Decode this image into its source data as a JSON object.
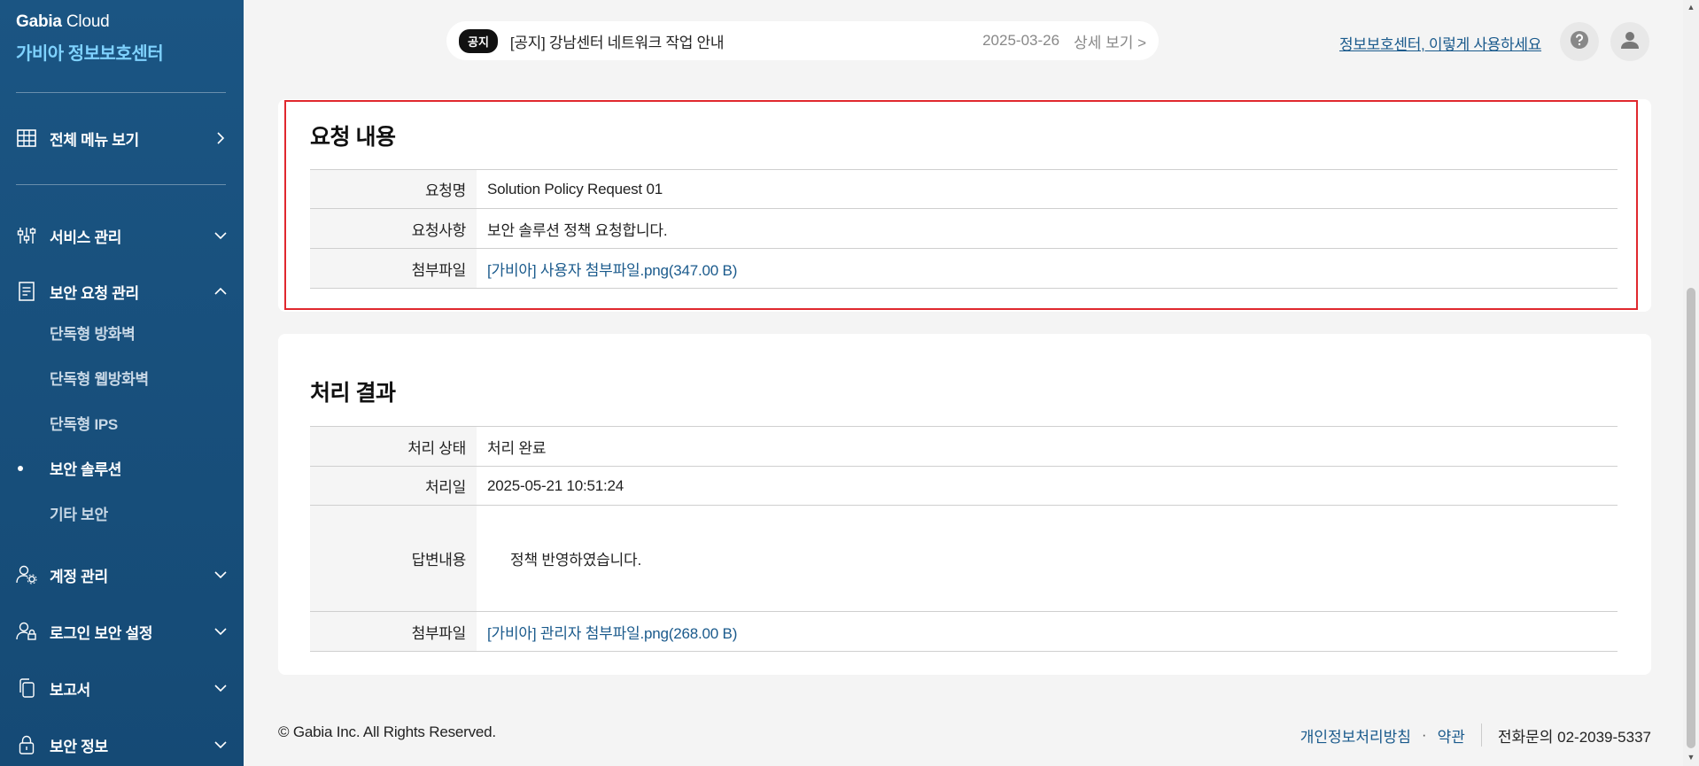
{
  "brand": {
    "company": "Gabia",
    "product": "Cloud",
    "subtitle": "가비아 정보보호센터"
  },
  "sidebar": {
    "all_menu": "전체 메뉴 보기",
    "groups": [
      {
        "label": "서비스 관리",
        "icon": "sliders-icon"
      },
      {
        "label": "보안 요청 관리",
        "icon": "document-icon"
      },
      {
        "label": "계정 관리",
        "icon": "user-gear-icon"
      },
      {
        "label": "로그인 보안 설정",
        "icon": "user-lock-icon"
      },
      {
        "label": "보고서",
        "icon": "copy-icon"
      },
      {
        "label": "보안 정보",
        "icon": "lock-icon"
      }
    ],
    "sub_items": [
      "단독형 방화벽",
      "단독형 웹방화벽",
      "단독형 IPS",
      "보안 솔루션",
      "기타 보안"
    ],
    "active_sub": "보안 솔루션"
  },
  "notice": {
    "badge": "공지",
    "text": "[공지] 강남센터 네트워크 작업 안내",
    "date": "2025-03-26",
    "more": "상세 보기 >"
  },
  "header": {
    "help_link": "정보보호센터, 이렇게 사용하세요"
  },
  "request": {
    "title": "요청 내용",
    "rows": [
      {
        "label": "요청명",
        "value": "Solution Policy Request 01"
      },
      {
        "label": "요청사항",
        "value": "보안 솔루션 정책 요청합니다."
      },
      {
        "label": "첨부파일",
        "value": "[가비아] 사용자 첨부파일.png(347.00 B)"
      }
    ]
  },
  "result": {
    "title": "처리 결과",
    "rows": [
      {
        "label": "처리 상태",
        "value": "처리 완료"
      },
      {
        "label": "처리일",
        "value": "2025-05-21 10:51:24"
      },
      {
        "label": "답변내용",
        "value": "정책 반영하였습니다."
      },
      {
        "label": "첨부파일",
        "value": "[가비아] 관리자 첨부파일.png(268.00 B)"
      }
    ]
  },
  "footer": {
    "copyright": "© Gabia Inc. All Rights Reserved.",
    "privacy": "개인정보처리방침",
    "sep": "·",
    "terms": "약관",
    "phone": "전화문의 02-2039-5337"
  },
  "colors": {
    "sidebar": "#1b5583",
    "accent": "#7fd2ff",
    "link": "#1a5a8c",
    "highlight": "#e0282e"
  }
}
